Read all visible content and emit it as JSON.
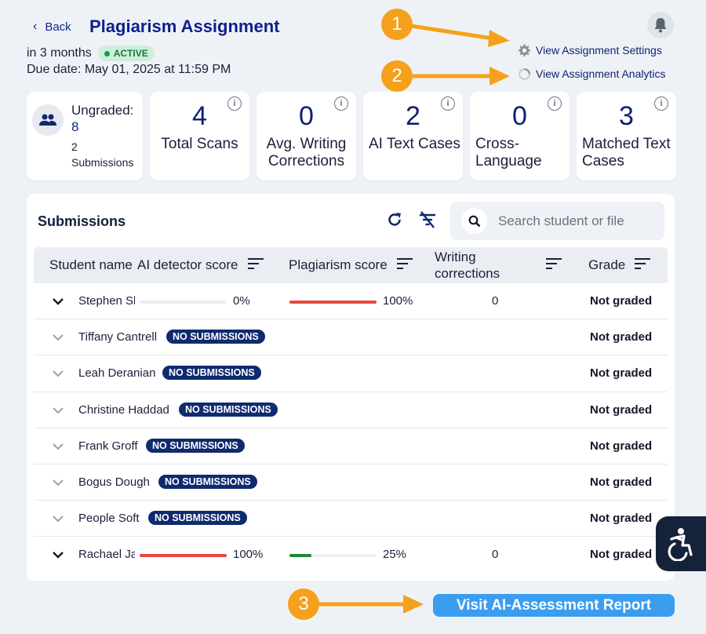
{
  "header": {
    "back_label": "Back",
    "title": "Plagiarism Assignment",
    "relative_time": "in 3 months",
    "status": "ACTIVE",
    "due_date": "Due date: May 01, 2025 at 11:59 PM",
    "links": {
      "settings": "View Assignment Settings",
      "analytics": "View Assignment Analytics"
    }
  },
  "callouts": [
    "1",
    "2",
    "3"
  ],
  "stats": {
    "ungraded_label": "Ungraded:",
    "ungraded_value": "8",
    "submissions_value": "2",
    "submissions_label": "Submissions",
    "cards": [
      {
        "value": "4",
        "label": "Total Scans"
      },
      {
        "value": "0",
        "label": "Avg. Writing Corrections"
      },
      {
        "value": "2",
        "label": "AI Text Cases"
      },
      {
        "value": "0",
        "label": "Cross-Language"
      },
      {
        "value": "3",
        "label": "Matched Text Cases"
      }
    ],
    "info_glyph": "i"
  },
  "submissions": {
    "title": "Submissions",
    "search_placeholder": "Search student or file",
    "columns": {
      "student": "Student name",
      "ai": "AI detector score",
      "plag": "Plagiarism score",
      "writing": "Writing corrections",
      "grade": "Grade"
    },
    "no_sub_label": "NO SUBMISSIONS",
    "rows": [
      {
        "name": "Stephen Sh",
        "ai": "0%",
        "ai_value": 0,
        "plag": "100%",
        "plag_value": 100,
        "wc": "0",
        "grade": "Not graded"
      },
      {
        "name": "Tiffany Cantrell",
        "grade": "Not graded"
      },
      {
        "name": "Leah Deranian",
        "grade": "Not graded"
      },
      {
        "name": "Christine Haddad",
        "grade": "Not graded"
      },
      {
        "name": "Frank Groff",
        "grade": "Not graded"
      },
      {
        "name": "Bogus Dough",
        "grade": "Not graded"
      },
      {
        "name": "People Soft",
        "grade": "Not graded"
      },
      {
        "name": "Rachael Jac",
        "ai": "100%",
        "ai_value": 100,
        "plag": "25%",
        "plag_value": 25,
        "wc": "0",
        "grade": "Not graded"
      }
    ]
  },
  "report_button": "Visit AI-Assessment Report",
  "colors": {
    "navy": "#0f1f8c",
    "active_bg": "#cdeedb",
    "badge_navy": "#0f2a6f",
    "red_bar": "#e8483c",
    "green_bar": "#1a8a30",
    "button_blue": "#3a9df0",
    "callout_orange": "#f5a11b"
  }
}
